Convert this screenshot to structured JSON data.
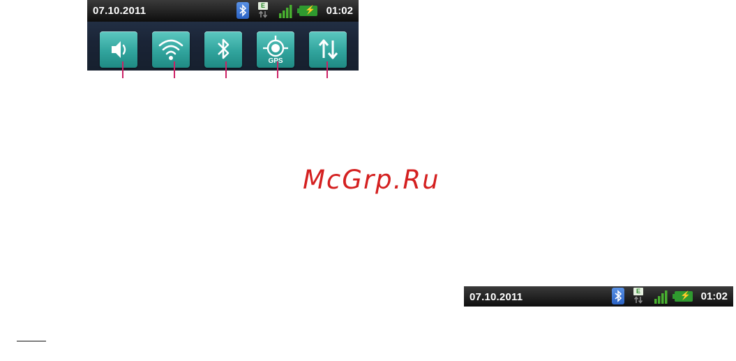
{
  "top_panel": {
    "status_bar": {
      "date": "07.10.2011",
      "clock": "01:02",
      "network_letter": "E",
      "icons": [
        "bluetooth-icon",
        "edge-data-icon",
        "signal-bars-icon",
        "battery-charging-icon"
      ]
    },
    "quick_settings": {
      "gps_label": "GPS",
      "tiles": [
        "sound-toggle",
        "wifi-toggle",
        "bluetooth-toggle",
        "gps-toggle",
        "data-toggle"
      ]
    }
  },
  "watermark": "McGrp.Ru",
  "bottom_status_bar": {
    "date": "07.10.2011",
    "clock": "01:02",
    "network_letter": "E"
  },
  "colors": {
    "tile": "#31a49d",
    "status_bar": "#1a1a1a",
    "leader_line": "#cc2266",
    "watermark": "#d42020",
    "battery": "#2f9a2f"
  }
}
